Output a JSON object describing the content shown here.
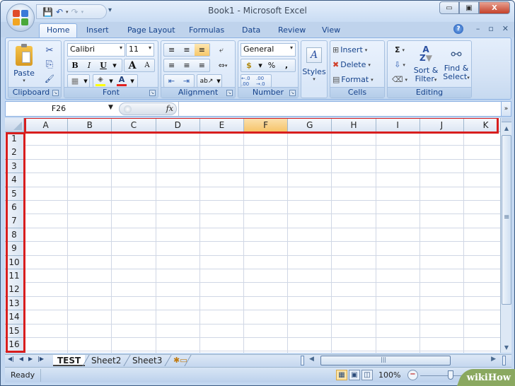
{
  "window": {
    "title": "Book1 - Microsoft Excel",
    "controls": {
      "minimize": "▭",
      "restore": "▣",
      "close": "X"
    }
  },
  "quick_access": {
    "save_icon": "💾",
    "undo_icon": "↶",
    "redo_icon": "↷",
    "customize_icon": "▾"
  },
  "tabs": [
    "Home",
    "Insert",
    "Page Layout",
    "Formulas",
    "Data",
    "Review",
    "View"
  ],
  "active_tab": "Home",
  "help_icon": "?",
  "ribbon": {
    "clipboard": {
      "label": "Clipboard",
      "paste": "Paste",
      "cut_icon": "✂",
      "copy_icon": "⎘",
      "format_painter_icon": "🖌"
    },
    "font": {
      "label": "Font",
      "font_name": "Calibri",
      "font_size": "11",
      "bold": "B",
      "italic": "I",
      "underline": "U",
      "grow": "A",
      "shrink": "A",
      "border_icon": "▦",
      "fill_icon": "◈",
      "font_color_icon": "A",
      "fill_color": "#ffff00",
      "font_color": "#e02020"
    },
    "alignment": {
      "label": "Alignment",
      "top_icon": "≡",
      "middle_icon": "≡",
      "bottom_icon": "≡",
      "wrap_icon": "⤶",
      "left_icon": "≡",
      "center_icon": "≡",
      "right_icon": "≡",
      "merge_icon": "⇔",
      "decrease_indent_icon": "⇤",
      "increase_indent_icon": "⇥",
      "orientation_icon": "ab↗"
    },
    "number": {
      "label": "Number",
      "format": "General",
      "currency_icon": "$",
      "percent": "%",
      "comma": ",",
      "inc_decimal": "←.0 .00",
      "dec_decimal": ".00 →.0"
    },
    "styles": {
      "label": "Styles"
    },
    "cells": {
      "label": "Cells",
      "insert": "Insert",
      "delete": "Delete",
      "format": "Format"
    },
    "editing": {
      "label": "Editing",
      "sum_icon": "Σ",
      "fill_icon": "⇩",
      "clear_icon": "⌫",
      "sort_filter_line1": "Sort &",
      "sort_filter_line2": "Filter",
      "find_select_line1": "Find &",
      "find_select_line2": "Select"
    }
  },
  "formula_bar": {
    "name_box": "F26",
    "fx": "fx",
    "value": ""
  },
  "grid": {
    "columns": [
      "A",
      "B",
      "C",
      "D",
      "E",
      "F",
      "G",
      "H",
      "I",
      "J",
      "K"
    ],
    "selected_column": "F",
    "rows": [
      "1",
      "2",
      "3",
      "4",
      "5",
      "6",
      "7",
      "8",
      "9",
      "10",
      "11",
      "12",
      "13",
      "14",
      "15",
      "16"
    ],
    "highlight_color": "#d81e1e"
  },
  "sheets": [
    "TEST",
    "Sheet2",
    "Sheet3"
  ],
  "active_sheet": "TEST",
  "sheet_nav": {
    "first": "◀|",
    "prev": "◀",
    "next": "▶",
    "last": "|▶"
  },
  "status": {
    "text": "Ready",
    "zoom": "100%"
  },
  "watermark": "wikiHow"
}
